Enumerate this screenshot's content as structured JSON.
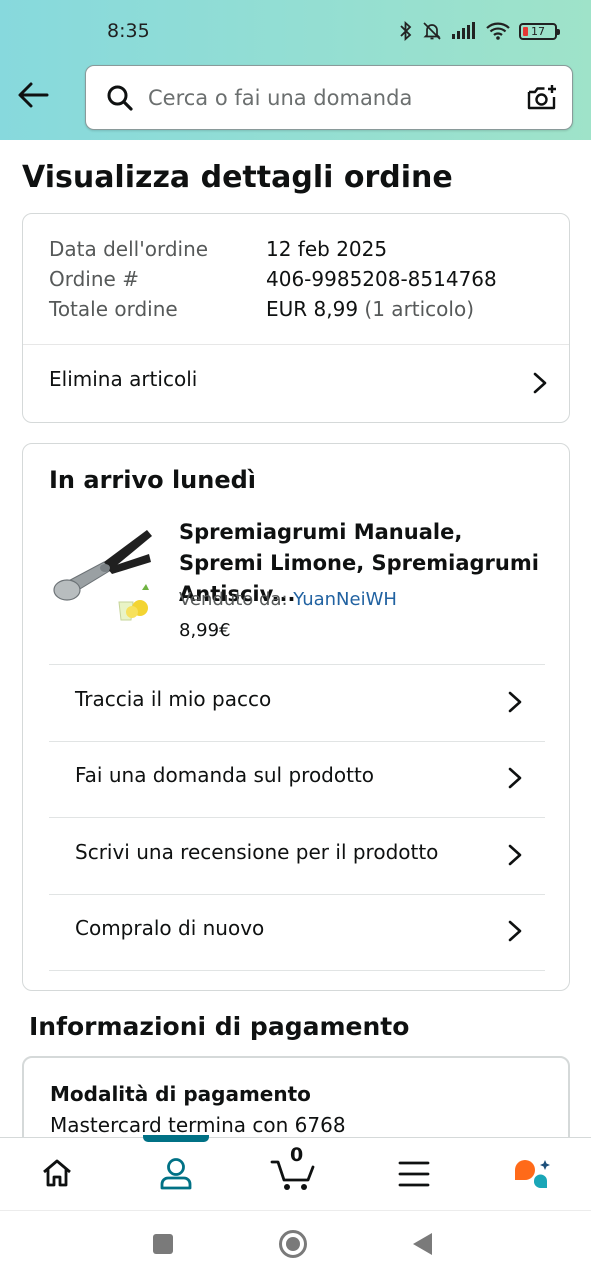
{
  "status_bar": {
    "time": "8:35",
    "battery": "17"
  },
  "search": {
    "placeholder": "Cerca o fai una domanda"
  },
  "page": {
    "title": "Visualizza dettagli ordine"
  },
  "order": {
    "date_label": "Data dell'ordine",
    "date_value": "12 feb 2025",
    "number_label": "Ordine #",
    "number_value": "406-9985208-8514768",
    "total_label": "Totale ordine",
    "total_value": "EUR 8,99",
    "total_items": "(1 articolo)",
    "delete_items": "Elimina articoli"
  },
  "shipment": {
    "arrival": "In arrivo lunedì",
    "product_title": "Spremiagrumi Manuale, Spremi Limone, Spremiagrumi Antisciv...",
    "sold_by_label": "Venduto da:",
    "seller": "YuanNeiWH",
    "price": "8,99€",
    "actions": [
      "Traccia il mio pacco",
      "Fai una domanda sul prodotto",
      "Scrivi una recensione per il prodotto",
      "Compralo di nuovo"
    ]
  },
  "payment": {
    "section_title": "Informazioni di pagamento",
    "method_label": "Modalità di pagamento",
    "method_value": "Mastercard termina con 6768"
  },
  "bottom_nav": {
    "cart_count": "0",
    "active": "account"
  },
  "colors": {
    "header_from": "#87d9dd",
    "header_to": "#9fe3c9",
    "link": "#2162a1",
    "accent": "#007185"
  }
}
